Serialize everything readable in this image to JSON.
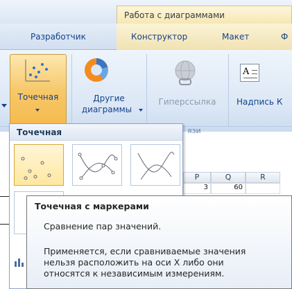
{
  "context_tab": {
    "label": "Работа с диаграммами"
  },
  "tabs": [
    {
      "label": "Разработчик"
    },
    {
      "label": "Конструктор"
    },
    {
      "label": "Макет"
    },
    {
      "label": "Ф"
    }
  ],
  "ribbon": {
    "scatter_button": {
      "label": "Точечная"
    },
    "other_charts_button": {
      "line1": "Другие",
      "line2": "диаграммы"
    },
    "hyperlink_button": {
      "label": "Гиперссылка"
    },
    "textbox_button": {
      "label": "Надпись",
      "suffix": "К"
    },
    "group_label_partial": "язи"
  },
  "gallery": {
    "header": "Точечная",
    "thumbs": [
      {
        "name": "scatter-markers",
        "selected": true
      },
      {
        "name": "scatter-smooth-markers",
        "selected": false
      },
      {
        "name": "scatter-smooth",
        "selected": false
      }
    ]
  },
  "sheet": {
    "columns": [
      "P",
      "Q",
      "R"
    ],
    "row": [
      "3",
      "60",
      ""
    ]
  },
  "tooltip": {
    "title": "Точечная с маркерами",
    "subtitle": "Сравнение пар значений.",
    "body_lines": [
      "Применяется, если сравниваемые значения",
      "нельзя расположить на оси X либо они",
      "относятся к независимым измерениям."
    ]
  },
  "colors": {
    "ribbon_text": "#15428b",
    "selected_button": "#f7c86a",
    "context_tab": "#f6e7b4"
  }
}
